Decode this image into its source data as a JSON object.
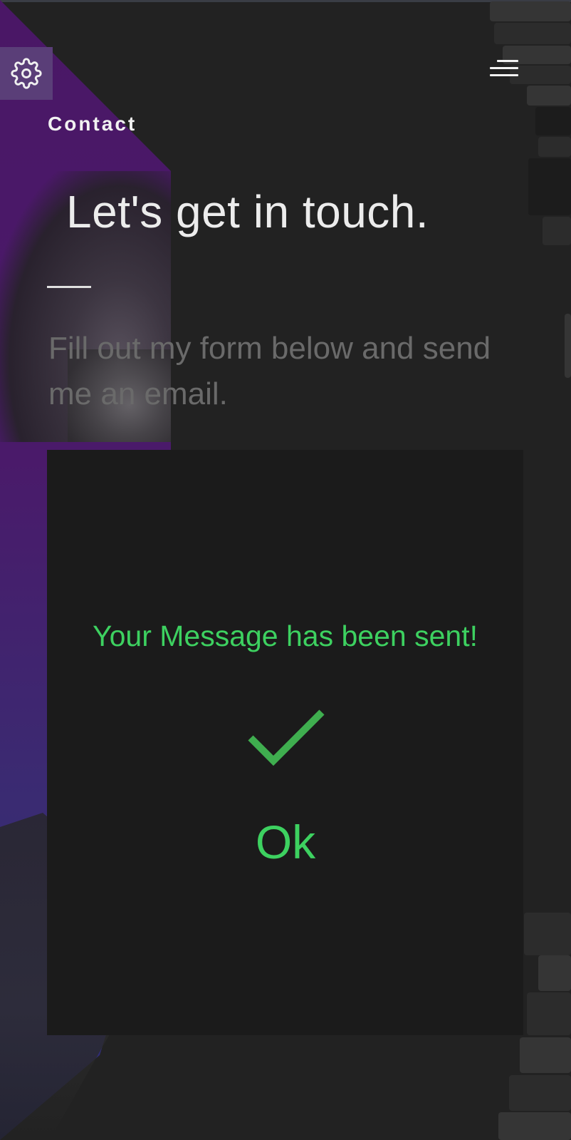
{
  "header": {
    "section_label": "Contact",
    "settings_icon": "gear-icon",
    "menu_icon": "hamburger-menu-icon"
  },
  "main": {
    "title": "Let's get in touch.",
    "subtitle": "Fill out my form below and send me an email."
  },
  "modal": {
    "message": "Your Message has been sent!",
    "icon": "checkmark-icon",
    "ok_label": "Ok",
    "accent_color": "#3dd160"
  },
  "theme": {
    "background": "#222222",
    "panel_purple": "#4a1766",
    "modal_background": "#1b1b1b"
  }
}
